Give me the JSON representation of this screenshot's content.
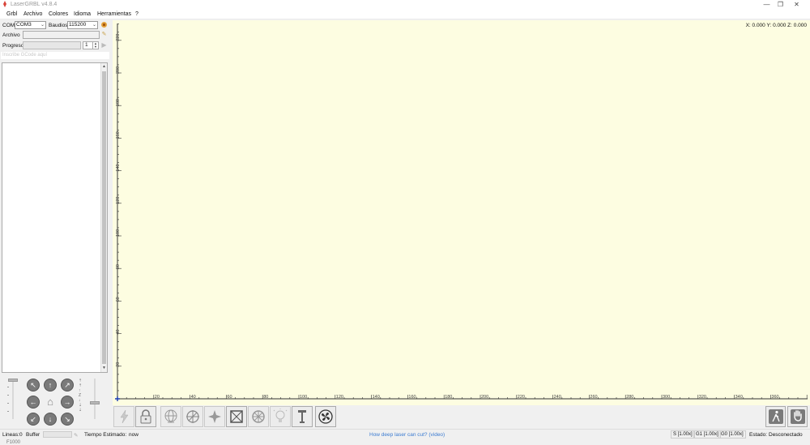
{
  "window": {
    "title": "LaserGRBL v4.8.4",
    "minimize": "—",
    "restore": "❐",
    "close": "✕"
  },
  "menu": [
    "Grbl",
    "Archivo",
    "Colores",
    "Idioma",
    "Herramientas",
    "?"
  ],
  "left": {
    "com_label": "COM",
    "com_value": "COM3",
    "baud_label": "Baudios",
    "baud_value": "115200",
    "file_label": "Archivo",
    "file_value": "",
    "progress_label": "Progreso",
    "progress_percent": 0,
    "copies_value": "1",
    "command_placeholder": "Inscribe GCode aquí",
    "feed_label": "F1000",
    "z_label": "Z"
  },
  "canvas": {
    "coordinates": "X: 0.000 Y: 0.000 Z: 0.000",
    "x_ticks": [
      "20",
      "40",
      "60",
      "80",
      "100",
      "120",
      "140",
      "160",
      "180",
      "200",
      "220",
      "240",
      "260",
      "280",
      "300",
      "320",
      "340",
      "360"
    ],
    "y_ticks": [
      "20",
      "40",
      "60",
      "80",
      "100",
      "120",
      "140",
      "160",
      "180",
      "200",
      "220"
    ],
    "background": "#fdfde1"
  },
  "toolbar": {
    "buttons": [
      "reset-icon",
      "unlock-icon",
      "globe-icon",
      "center-target-icon",
      "star-icon",
      "frame-icon",
      "wheel-icon",
      "lamp-icon",
      "laser-focus-icon",
      "fan-icon"
    ],
    "right_buttons": [
      "walk-icon",
      "stop-hand-icon"
    ]
  },
  "status": {
    "lines_label": "Lineas:",
    "lines_value": "0",
    "buffer_label": "Buffer",
    "time_label": "Tiempo Estimado:",
    "time_value": "now",
    "link_text": "How deep laser can cut? (video)",
    "s_override": "S [1.00x]",
    "g1_override": "G1 [1.00x]",
    "g0_override": "G0 [1.00x]",
    "state_label": "Estado:",
    "state_value": "Desconectado"
  }
}
